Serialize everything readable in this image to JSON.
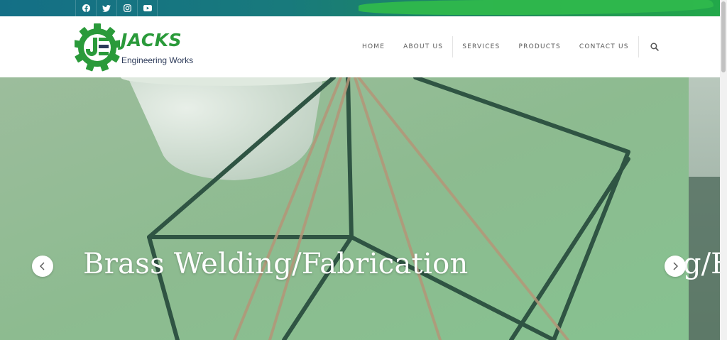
{
  "topbar": {
    "social": [
      {
        "name": "facebook",
        "icon": "facebook-icon"
      },
      {
        "name": "twitter",
        "icon": "twitter-icon"
      },
      {
        "name": "instagram",
        "icon": "instagram-icon"
      },
      {
        "name": "youtube",
        "icon": "youtube-icon"
      }
    ]
  },
  "logo": {
    "monogram": "JE",
    "brand": "JACKS",
    "tagline": "Engineering Works"
  },
  "nav": {
    "items": [
      "HOME",
      "ABOUT US",
      "SERVICES",
      "PRODUCTS",
      "CONTACT US"
    ],
    "search_icon": "search-icon"
  },
  "hero": {
    "title": "Brass Welding/Fabrication",
    "next_title_peek": "g/F",
    "prev_icon": "chevron-left-icon",
    "next_icon": "chevron-right-icon"
  },
  "colors": {
    "brand_green": "#2a9a3a",
    "brand_navy": "#2d3b5a",
    "topbar_teal": "#146f86"
  }
}
